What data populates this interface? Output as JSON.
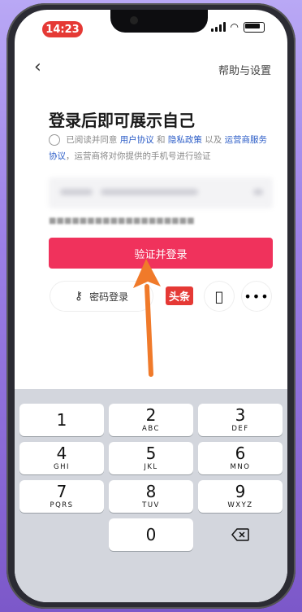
{
  "status_bar": {
    "time": "14:23"
  },
  "nav": {
    "back_icon": "chevron-left-icon",
    "help_label": "帮助与设置"
  },
  "login": {
    "title": "登录后即可展示自己",
    "agree_prefix": "已阅读并同意",
    "user_agreement": "用户协议",
    "and": "和",
    "privacy_policy": "隐私政策",
    "and2": "以及",
    "carrier_service": "运营商服务",
    "agreement_suffix": "协议",
    "agree_tail": "，运营商将对你提供的手机号进行验证",
    "verify_button": "验证并登录",
    "password_login": "密码登录"
  },
  "watermark": "头条",
  "keyboard": {
    "keys": [
      {
        "num": "1",
        "letters": ""
      },
      {
        "num": "2",
        "letters": "ABC"
      },
      {
        "num": "3",
        "letters": "DEF"
      },
      {
        "num": "4",
        "letters": "GHI"
      },
      {
        "num": "5",
        "letters": "JKL"
      },
      {
        "num": "6",
        "letters": "MNO"
      },
      {
        "num": "7",
        "letters": "PQRS"
      },
      {
        "num": "8",
        "letters": "TUV"
      },
      {
        "num": "9",
        "letters": "WXYZ"
      },
      {
        "num": "0",
        "letters": ""
      }
    ]
  },
  "colors": {
    "accent": "#f0325c",
    "link": "#2b5cc7",
    "arrow": "#f07a2a"
  }
}
